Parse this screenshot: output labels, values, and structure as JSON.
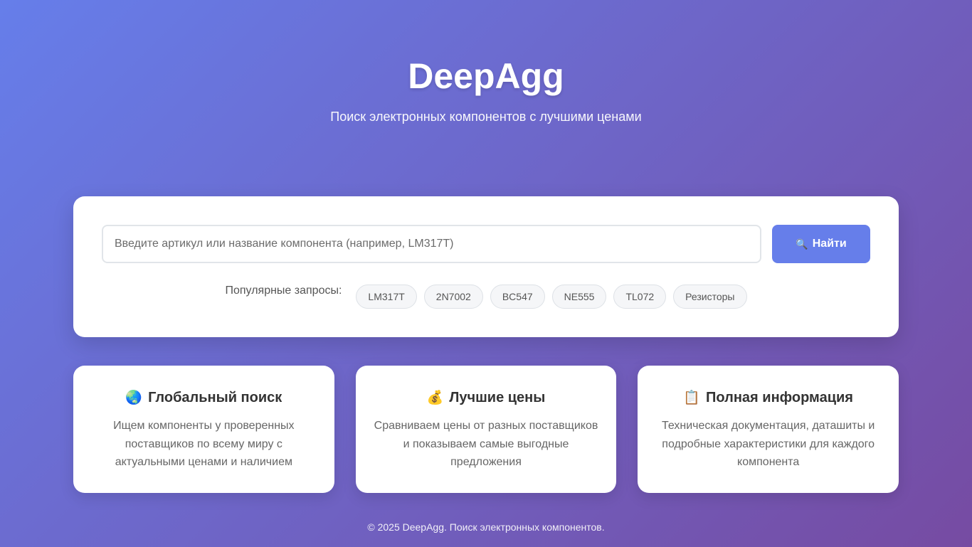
{
  "header": {
    "title": "DeepAgg",
    "subtitle": "Поиск электронных компонентов с лучшими ценами"
  },
  "search": {
    "placeholder": "Введите артикул или название компонента (например, LM317T)",
    "value": "",
    "button_icon": "🔍",
    "button_label": "Найти",
    "popular_label": "Популярные запросы:",
    "popular": [
      "LM317T",
      "2N7002",
      "BC547",
      "NE555",
      "TL072",
      "Резисторы"
    ]
  },
  "features": [
    {
      "icon": "🌏",
      "icon_name": "globe-icon",
      "title": "Глобальный поиск",
      "desc": "Ищем компоненты у проверенных поставщиков по всему миру с актуальными ценами и наличием"
    },
    {
      "icon": "💰",
      "icon_name": "money-bag-icon",
      "title": "Лучшие цены",
      "desc": "Сравниваем цены от разных поставщиков и показываем самые выгодные предложения"
    },
    {
      "icon": "📋",
      "icon_name": "clipboard-icon",
      "title": "Полная информация",
      "desc": "Техническая документация, даташиты и подробные характеристики для каждого компонента"
    }
  ],
  "footer": {
    "text": "© 2025 DeepAgg. Поиск электронных компонентов."
  },
  "colors": {
    "gradient_start": "#667eea",
    "gradient_end": "#764ba2",
    "accent": "#667eea"
  }
}
